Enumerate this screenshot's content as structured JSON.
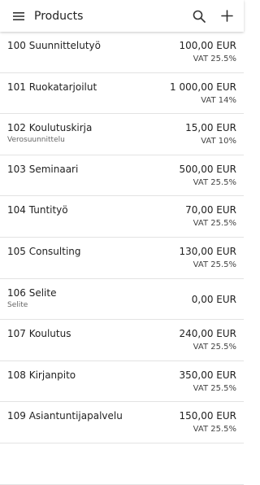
{
  "header": {
    "title": "Products",
    "menu_icon": "menu-icon",
    "search_icon": "search-icon",
    "add_icon": "plus-icon"
  },
  "products": [
    {
      "name": "100 Suunnittelutyö",
      "subtitle": "",
      "price": "100,00 EUR",
      "vat": "VAT 25.5%"
    },
    {
      "name": "101 Ruokatarjoilut",
      "subtitle": "",
      "price": "1 000,00 EUR",
      "vat": "VAT 14%"
    },
    {
      "name": "102 Koulutuskirja",
      "subtitle": "Verosuunnittelu",
      "price": "15,00 EUR",
      "vat": "VAT 10%"
    },
    {
      "name": "103 Seminaari",
      "subtitle": "",
      "price": "500,00 EUR",
      "vat": "VAT 25.5%"
    },
    {
      "name": "104 Tuntityö",
      "subtitle": "",
      "price": "70,00 EUR",
      "vat": "VAT 25.5%"
    },
    {
      "name": "105 Consulting",
      "subtitle": "",
      "price": "130,00 EUR",
      "vat": "VAT 25.5%"
    },
    {
      "name": "106 Selite",
      "subtitle": "Selite",
      "price": "0,00 EUR",
      "vat": ""
    },
    {
      "name": "107 Koulutus",
      "subtitle": "",
      "price": "240,00 EUR",
      "vat": "VAT 25.5%"
    },
    {
      "name": "108 Kirjanpito",
      "subtitle": "",
      "price": "350,00 EUR",
      "vat": "VAT 25.5%"
    },
    {
      "name": "109 Asiantuntijapalvelu",
      "subtitle": "",
      "price": "150,00 EUR",
      "vat": "VAT 25.5%"
    },
    {
      "name": "",
      "subtitle": "",
      "price": "",
      "vat": ""
    }
  ]
}
